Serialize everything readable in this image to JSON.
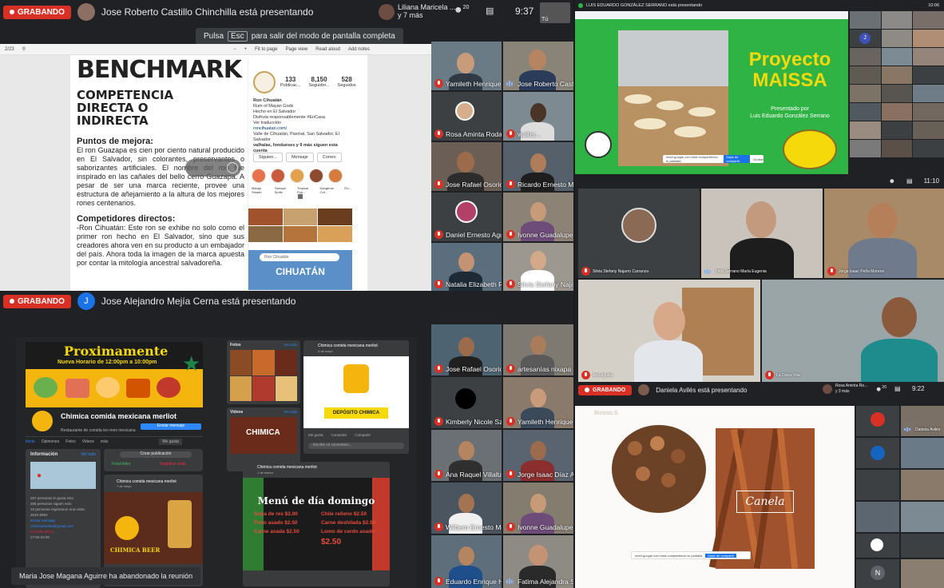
{
  "q1": {
    "recording_label": "GRABANDO",
    "presenter_text": "Jose Roberto Castillo Chinchilla está presentando",
    "esc_hint_prefix": "Pulsa",
    "esc_key": "Esc",
    "esc_hint_suffix": "para salir del modo de pantalla completa",
    "other_participant": "Liliana Maricela ...",
    "other_count": "y 7 más",
    "people_count": "20",
    "clock": "9:37",
    "self_label": "Tú",
    "doc": {
      "title": "BENCHMARK",
      "subtitle_1": "COMPETENCIA",
      "subtitle_2": "DIRECTA O",
      "subtitle_3": "INDIRECTA",
      "section1_title": "Puntos de mejora:",
      "section1_text": "El ron Guazapa es cien por ciento natural producido en El Salvador, sin colorantes, preservantes o saborizantes artificiales. El nombre del ron fue inspirado en las cañales del bello cerro Guazapa. A pesar de ser una marca reciente, provee una estructura de añejamiento a la altura de los mejores rones centenarios.",
      "section2_title": "Competidores directos:",
      "section2_text": "-Ron Cihuatán: Este ron se exhibe no solo como el primer ron hecho en El Salvador, sino que sus creadores ahora ven en su producto a un embajador del país. Ahora toda la imagen de la marca apuesta por contar la mitología ancestral salvadoreña.",
      "ig_posts": "133",
      "ig_posts_label": "Publicac...",
      "ig_followers": "8,150",
      "ig_followers_label": "Seguidor...",
      "ig_following": "528",
      "ig_following_label": "Seguidos",
      "ig_name": "Ron Cihuatán",
      "ig_bio_1": "Rum of Mayan Gods",
      "ig_bio_2": "Hecho en El Salvador",
      "ig_bio_3": "Disfruta responsablemente #EnCasa",
      "ig_bio_4": "Ver traducción",
      "ig_bio_5": "roncihuatan.com/",
      "ig_bio_6": "Valle de Cihuatán, Paxinal, San Salvador, El Salvador",
      "ig_bio_7": "valhalas, fondueses y 9 más siguen esta cuenta",
      "ig_btn_follow": "Siguien...",
      "ig_btn_msg": "Mensaje",
      "ig_btn_mail": "Correo",
      "ig_highlights": [
        "Mango Smash",
        "Tamaya Spritz",
        "Tropical Pun...",
        "Dangerus Cof...",
        "Flo..."
      ],
      "ig_search": "Ron Cihuatán",
      "ig_banner": "CIHUATÁN",
      "page_indicator": "2/23",
      "toolbar_fit": "Fit to page",
      "toolbar_view": "Page view",
      "toolbar_read": "Read aloud",
      "toolbar_notes": "Add notes"
    },
    "participants": [
      {
        "name": "Yamileth Henrique..."
      },
      {
        "name": "Jose Roberto Cast..."
      },
      {
        "name": "Rosa Aminta Roda..."
      },
      {
        "name": "walter..."
      },
      {
        "name": "Jose Rafael Osorio..."
      },
      {
        "name": "Ricardo Ernesto M..."
      },
      {
        "name": "Daniel Ernesto Agu..."
      },
      {
        "name": "Ivonne Guadalupe..."
      },
      {
        "name": "Natalia Elizabeth R..."
      },
      {
        "name": "Silvia Stefany Naja..."
      }
    ]
  },
  "q2": {
    "header_text": "LUIS EDUARDO GONZÁLEZ SERRANO está presentando",
    "slide_title_1": "Proyecto",
    "slide_title_2": "MAISSA",
    "slide_presented": "Presentado por",
    "slide_author": "Luis Eduardo González Serrano",
    "clock": "10:06",
    "share_notice": "meet.google.com está compartiendo tu pantalla",
    "share_stop": "Dejar de compartir",
    "share_hide": "Ocultar"
  },
  "q3": {
    "clock": "11:10",
    "participants": [
      {
        "name": "Silvia Stefany Najarro Carranza"
      },
      {
        "name": "Ortiz Serrano María Eugenia"
      },
      {
        "name": "Jorge Isaac Peña Moreno"
      },
      {
        "name": "Ana Aguilar"
      },
      {
        "name": "La Dolce Vita"
      }
    ]
  },
  "q4": {
    "recording_label": "GRABANDO",
    "presenter_initial": "J",
    "presenter_text": "Jose Alejandro Mejía Cerna está presentando",
    "fb": {
      "banner_title": "Proximamente",
      "banner_sub": "Nueva Horario de 12:00pm a 10:00pm",
      "page_name": "Chimica comida mexicana merliot",
      "page_category": "Restaurante de comida tex-mex mexicana",
      "send_msg": "Enviar mensaje",
      "tabs": [
        "Inicio",
        "Opiniones",
        "Fotos",
        "Videos",
        "más"
      ],
      "me_gusta": "Me gusta",
      "info_title": "Información",
      "see_all": "Ver todo",
      "create_post": "Crear publicación",
      "photo_btn": "Foto/video",
      "checkin_btn": "Registrar visita",
      "post_author": "Chimica comida mexicana merliot",
      "post_date": "7 de mayo",
      "likes_count": "257 personas le gusta esto",
      "follow_count": "266 personas siguen esto",
      "visits_count": "10 personas registraron una visita",
      "phone": "2510-5993",
      "msg_link": "Enviar mensaje",
      "email": "chimicamerliot@gmail.com",
      "hours_status": "Cerrado ahora",
      "hours": "17:00-22:00",
      "photos_title": "Fotos",
      "videos_title": "Videos",
      "video_label": "CHIMICA",
      "card_title": "Chimica comida mexicana merliot",
      "card_date": "4 de mayo",
      "card_logo_text": "DEPÓSITO CHIMICA",
      "like": "Me gusta",
      "comment": "Comentar",
      "share": "Compartir",
      "write_comment": "Escribe un comentario...",
      "menu_post_author": "Chimica comida mexicana merliot",
      "menu_post_date": "1 de marzo",
      "menu_title": "Menú de día domingo",
      "menu_items": [
        "Sopa de res $2.00",
        "Chile relleno $2.50",
        "Pollo asado $2.50",
        "Carne deshilada $2.50",
        "Carne asada $2.50",
        "Lomo de cerdo asado",
        "$2.50"
      ],
      "card2_title": "CHIMICA BEER"
    },
    "toast": "Maria Jose Magana Aguirre ha abandonado la reunión",
    "participants": [
      {
        "name": "Jose Rafael Osorio..."
      },
      {
        "name": "artesanías nixapa"
      },
      {
        "name": "Kimberly Nicole Szt..."
      },
      {
        "name": "Yamileth Henrique..."
      },
      {
        "name": "Ana Raquel Villalta ..."
      },
      {
        "name": "Jorge Isaac Díaz Al..."
      },
      {
        "name": "Wilbem Ernesto Mo..."
      },
      {
        "name": "Ivonne Guadalupe ..."
      },
      {
        "name": "Eduardo Enrique H..."
      },
      {
        "name": "Fatima Alejandra S..."
      }
    ]
  },
  "q5": {
    "recording_label": "GRABANDO",
    "presenter_text": "Daniela Avilés está presentando",
    "other_participant": "Rosa Aminta Ro...",
    "other_count": "y 3 más",
    "people_count": "20",
    "clock": "9:22",
    "slide_label": "Canela",
    "slide_corner": "Ricinus S",
    "share_notice": "meet.google.com está compartiendo tu pantalla",
    "share_stop": "Dejar de compartir",
    "participants": [
      {
        "name": "Daniela Avilés"
      }
    ],
    "initial_N": "N"
  },
  "colors": {
    "rec_red": "#d93025",
    "meet_dark": "#202124",
    "slide_green": "#2fb344",
    "slide_yellow": "#f5d90a",
    "fb_dark": "#242526",
    "fb_blue": "#2d88ff"
  }
}
